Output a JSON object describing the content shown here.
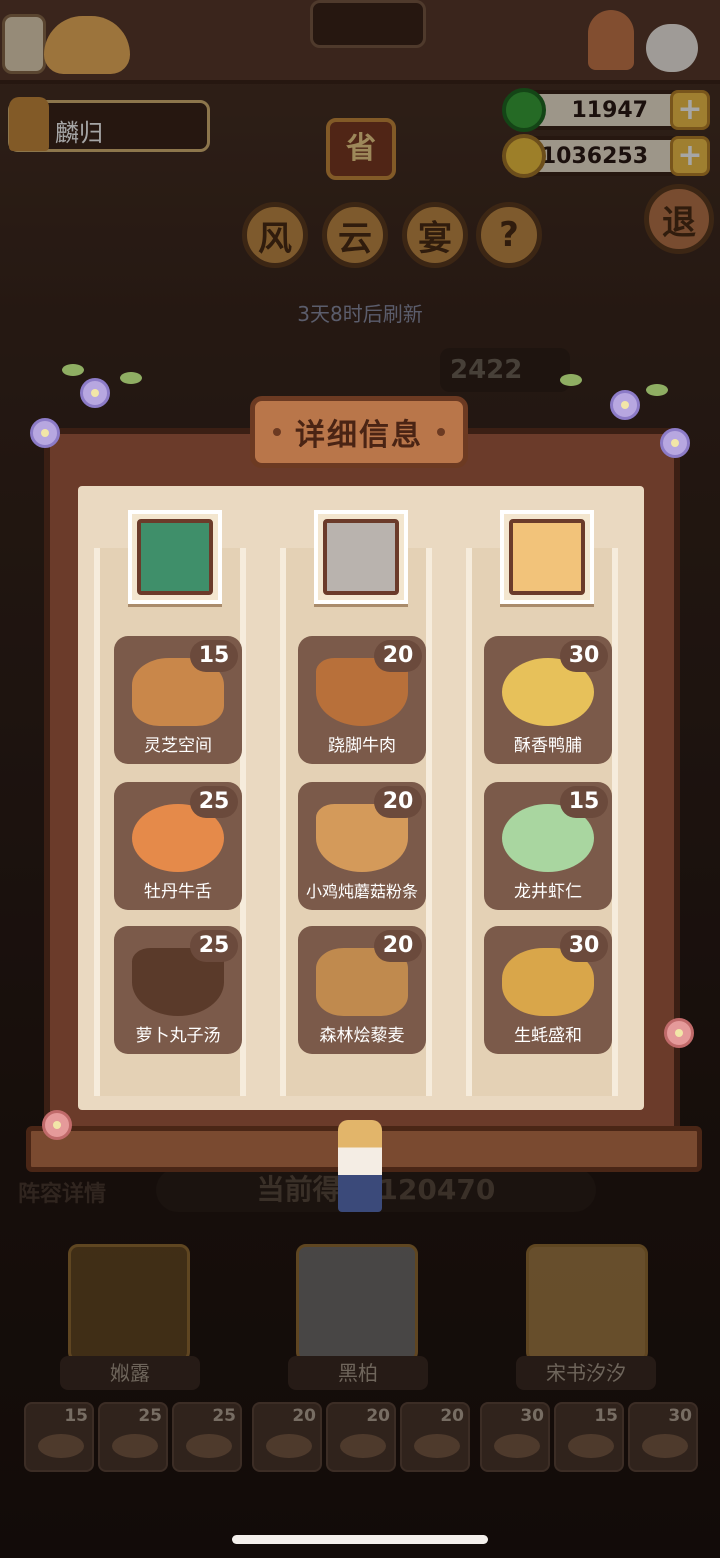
{
  "player": {
    "name": "麟归"
  },
  "currency": {
    "jade": "11947",
    "gold": "1036253"
  },
  "event": {
    "province_char": "省",
    "title_chars": [
      "风",
      "云",
      "宴"
    ],
    "help_char": "?",
    "refresh_text": "3天8时后刷新",
    "exit_char": "退",
    "partial_score": "2422"
  },
  "modal": {
    "title": "详细信息",
    "columns": [
      {
        "dishes": [
          {
            "name": "灵芝空间",
            "score": "15"
          },
          {
            "name": "牡丹牛舌",
            "score": "25"
          },
          {
            "name": "萝卜丸子汤",
            "score": "25"
          }
        ]
      },
      {
        "dishes": [
          {
            "name": "跷脚牛肉",
            "score": "20"
          },
          {
            "name": "小鸡炖蘑菇粉条",
            "score": "20"
          },
          {
            "name": "森林烩藜麦",
            "score": "20"
          }
        ]
      },
      {
        "dishes": [
          {
            "name": "酥香鸭脯",
            "score": "30"
          },
          {
            "name": "龙井虾仁",
            "score": "15"
          },
          {
            "name": "生蚝盛和",
            "score": "30"
          }
        ]
      }
    ]
  },
  "bottom": {
    "lineup_label": "阵容详情",
    "current_score_label": "当前得分",
    "current_score_value": "120470",
    "heroes": [
      "娰露",
      "黑柏",
      "宋书汐汐"
    ],
    "mini_scores": [
      "15",
      "25",
      "25",
      "20",
      "20",
      "20",
      "30",
      "15",
      "30"
    ]
  },
  "colors": {
    "accent_gold": "#f4c34b",
    "jade_green": "#3aa33a",
    "frame_brown": "#6b3b2a"
  }
}
